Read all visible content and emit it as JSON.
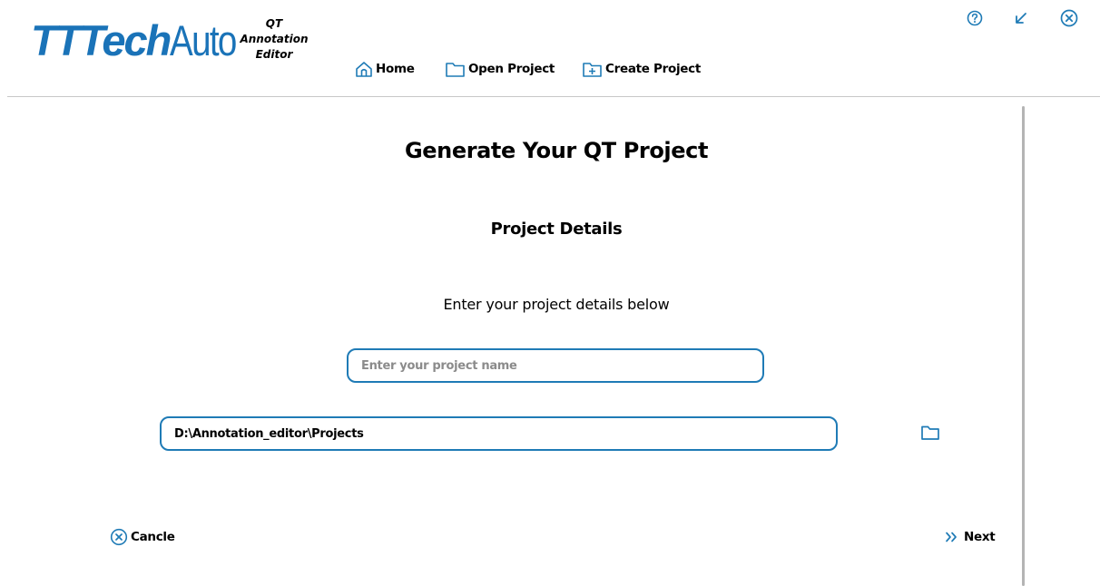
{
  "header": {
    "logo_bold": "TTTech",
    "logo_light": "Auto",
    "app_title": [
      "QT",
      "Annotation",
      "Editor"
    ],
    "nav": {
      "home": "Home",
      "open_project": "Open Project",
      "create_project": "Create Project"
    },
    "window_controls": [
      "help-icon",
      "minimize-arrow-icon",
      "close-icon"
    ]
  },
  "main": {
    "title": "Generate Your QT Project",
    "subtitle": "Project Details",
    "hint": "Enter your project details below",
    "project_name": {
      "value": "",
      "placeholder": "Enter your project name"
    },
    "project_path": {
      "value": "D:\\Annotation_editor\\Projects"
    },
    "browse_icon": "folder-icon"
  },
  "footer": {
    "cancel_label": "Cancle",
    "next_label": "Next"
  },
  "colors": {
    "accent": "#1f7bb6",
    "logo": "#1a73b8",
    "divider": "#c7c7c7"
  }
}
